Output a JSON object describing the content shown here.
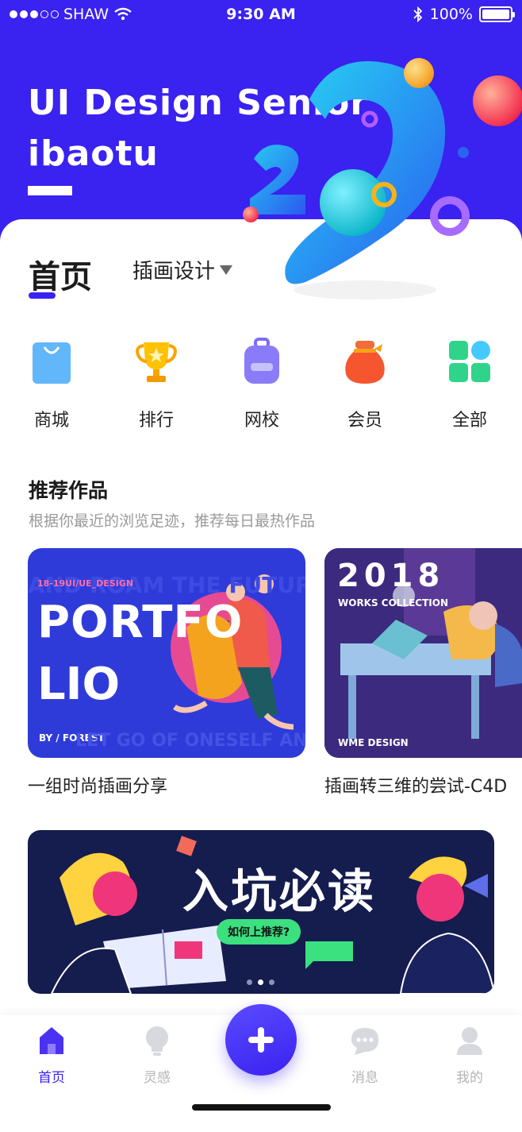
{
  "status_bar": {
    "carrier": "SHAW",
    "time": "9:30 AM",
    "battery": "100%"
  },
  "hero": {
    "title_line1": "UI Design Senior",
    "title_line2": "ibaotu",
    "brand_color": "#3a22f0"
  },
  "tabs": {
    "main": "首页",
    "sub": "插画设计"
  },
  "categories": [
    {
      "label": "商城",
      "icon": "shopping-bag-icon"
    },
    {
      "label": "排行",
      "icon": "trophy-icon"
    },
    {
      "label": "网校",
      "icon": "backpack-icon"
    },
    {
      "label": "会员",
      "icon": "money-bag-icon"
    },
    {
      "label": "全部",
      "icon": "grid-icon"
    }
  ],
  "section": {
    "title": "推荐作品",
    "subtitle": "根据你最近的浏览足迹，推荐每日最热作品"
  },
  "cards": [
    {
      "caption": "一组时尚插画分享",
      "art_top": "AND ROAM THE FUTURE",
      "art_tag": "18-19UI/UE_DESIGN",
      "art_word1": "PORTFO",
      "art_word2": "LIO",
      "art_by": "BY / FOREST",
      "art_bottom": "LET GO OF ONESELF AN"
    },
    {
      "caption": "插画转三维的尝试-C4D",
      "art_year": "2018",
      "art_sub": "WORKS COLLECTION",
      "art_by": "WME DESIGN"
    }
  ],
  "banner": {
    "title": "入坑必读",
    "pill": "如何上推荐?"
  },
  "tabbar": {
    "items": [
      {
        "label": "首页",
        "icon": "home-icon",
        "active": true
      },
      {
        "label": "灵感",
        "icon": "lightbulb-icon",
        "active": false
      },
      {
        "label": "消息",
        "icon": "chat-icon",
        "active": false
      },
      {
        "label": "我的",
        "icon": "user-icon",
        "active": false
      }
    ],
    "fab_icon": "plus-icon"
  }
}
